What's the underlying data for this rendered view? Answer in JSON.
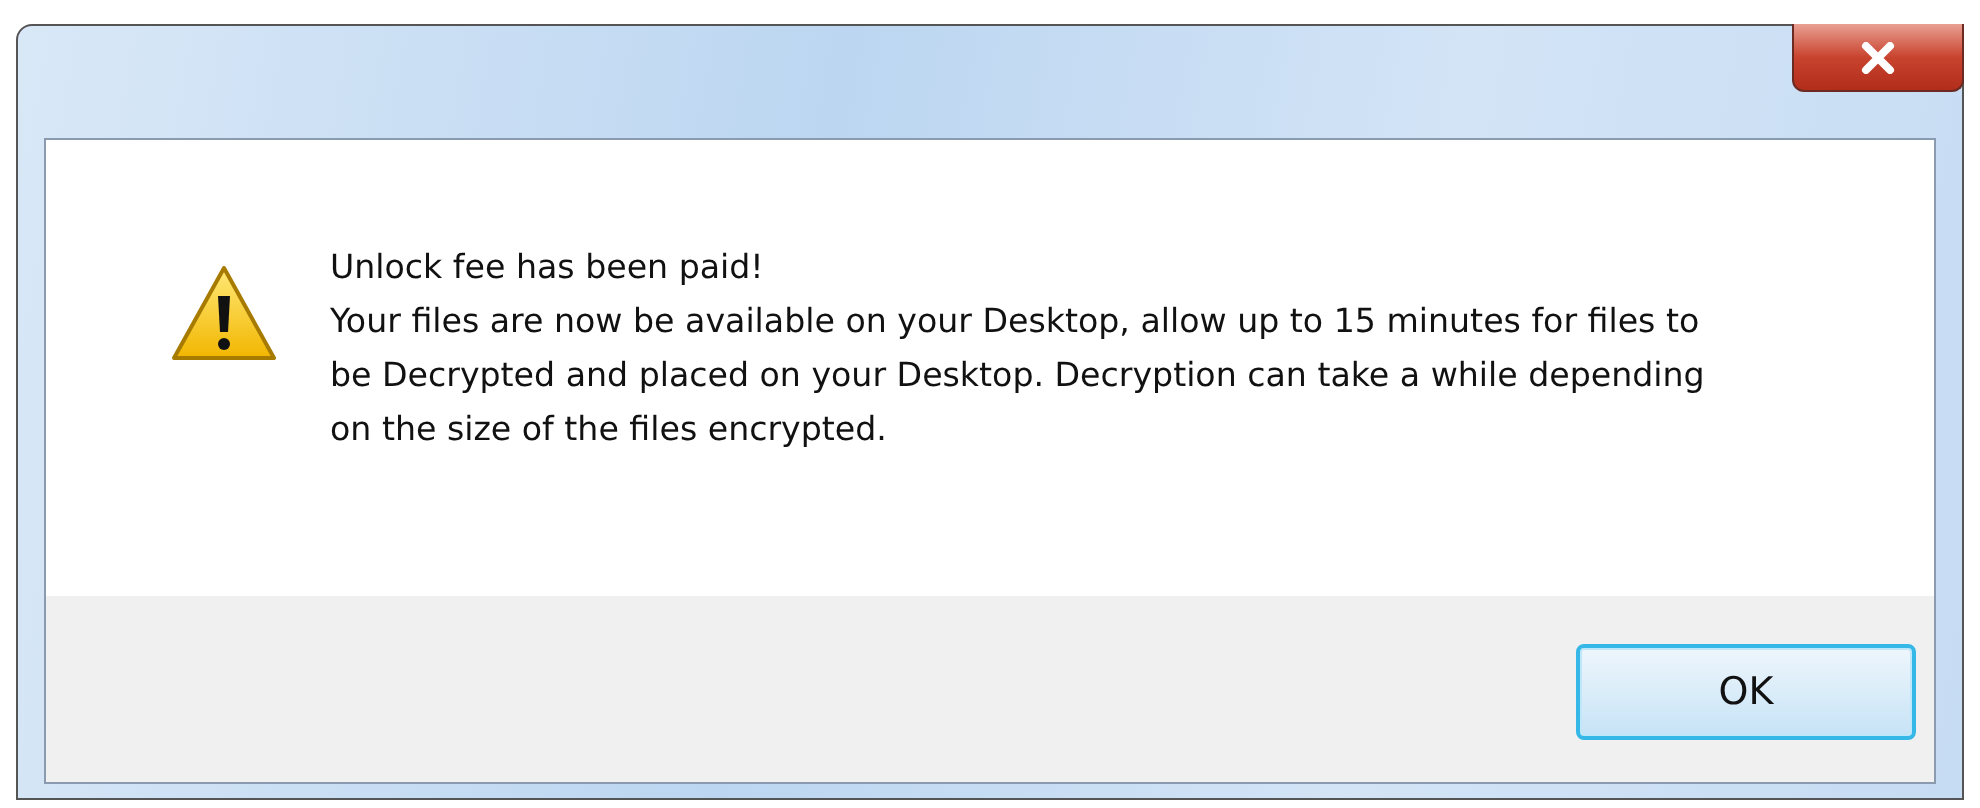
{
  "dialog": {
    "kind": "warning",
    "heading": "Unlock fee has been paid!",
    "message": "Your files are now be available on your Desktop, allow up to 15 minutes for files to be Decrypted and placed on your Desktop. Decryption can take a while depending on the size of the files encrypted.",
    "buttons": [
      "OK"
    ]
  }
}
